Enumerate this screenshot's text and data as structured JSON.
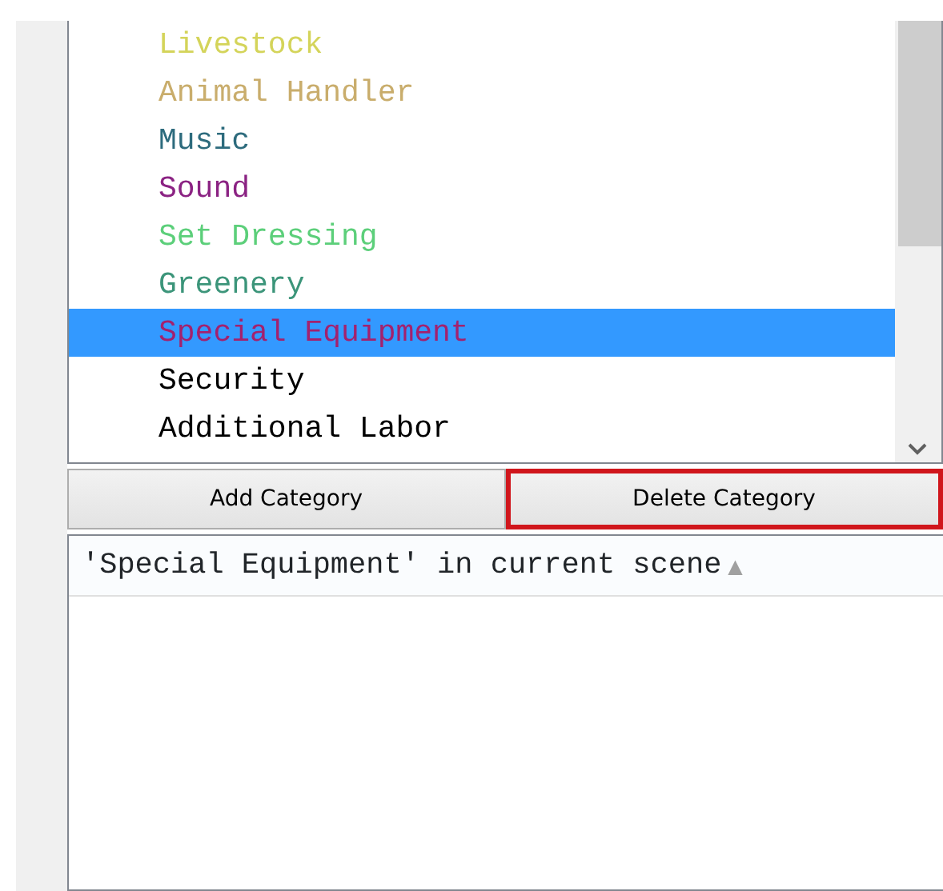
{
  "categories": [
    {
      "label": "Livestock",
      "color": "#d4d45a",
      "selected": false
    },
    {
      "label": "Animal Handler",
      "color": "#c9ad6c",
      "selected": false
    },
    {
      "label": "Music",
      "color": "#2d6b7d",
      "selected": false
    },
    {
      "label": "Sound",
      "color": "#8b2383",
      "selected": false
    },
    {
      "label": "Set Dressing",
      "color": "#5ccf7a",
      "selected": false
    },
    {
      "label": "Greenery",
      "color": "#3c957a",
      "selected": false
    },
    {
      "label": "Special Equipment",
      "color": "#a3216e",
      "selected": true
    },
    {
      "label": "Security",
      "color": "#000000",
      "selected": false
    },
    {
      "label": "Additional Labor",
      "color": "#000000",
      "selected": false
    }
  ],
  "buttons": [
    {
      "label": "Add Category",
      "highlighted": false
    },
    {
      "label": "Delete Category",
      "highlighted": true
    }
  ],
  "scene_header": {
    "label": "'Special Equipment' in current scene",
    "sort_indicator": "▲"
  }
}
